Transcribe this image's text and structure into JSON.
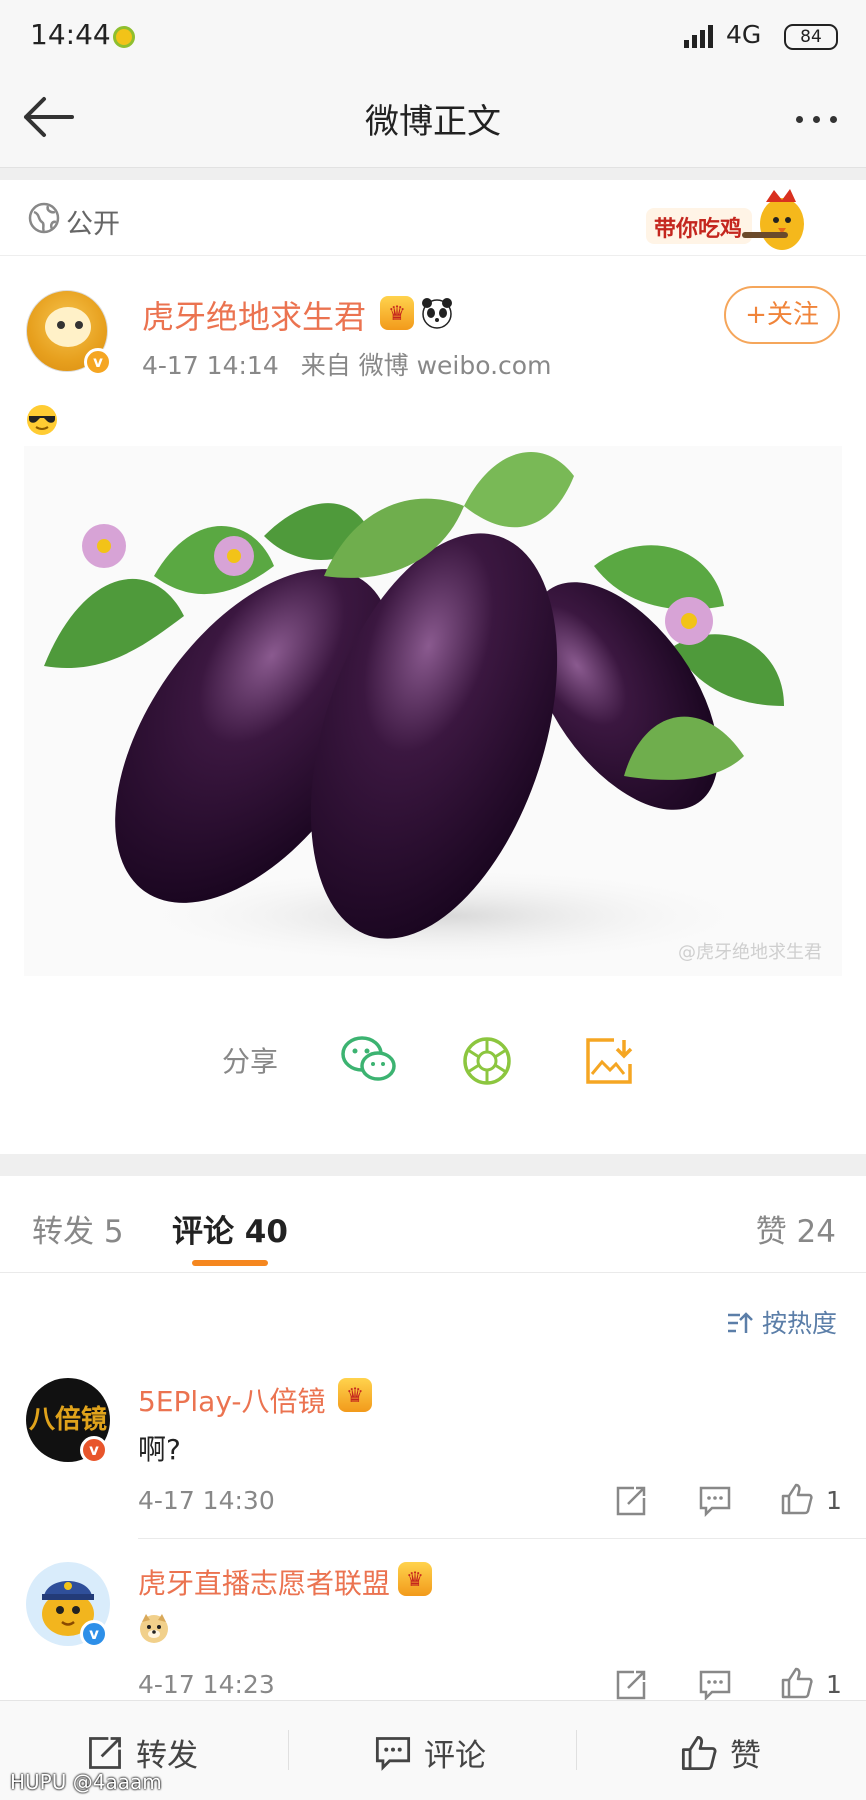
{
  "status_bar": {
    "time": "14:44",
    "network": "4G",
    "battery": "84"
  },
  "nav": {
    "title": "微博正文"
  },
  "visibility": "公开",
  "sticker_text": "带你吃鸡",
  "post": {
    "author": "虎牙绝地求生君",
    "time": "4-17 14:14",
    "source": "来自 微博 weibo.com",
    "follow_label": "+关注",
    "image_watermark": "@虎牙绝地求生君"
  },
  "share": {
    "label": "分享"
  },
  "tabs": {
    "repost": "转发 5",
    "comment": "评论 40",
    "like": "赞 24"
  },
  "sort_label": "按热度",
  "comments": [
    {
      "user": "5EPlay-八倍镜",
      "avatar_text": "八倍镜",
      "text": "啊?",
      "time": "4-17 14:30",
      "likes": "1"
    },
    {
      "user": "虎牙直播志愿者联盟",
      "text": "",
      "time": "4-17 14:23",
      "likes": "1"
    }
  ],
  "bottom_bar": {
    "repost": "转发",
    "comment": "评论",
    "like": "赞"
  },
  "footer_watermark": "HUPU @4aaam",
  "colors": {
    "accent_orange": "#eb7350",
    "link_blue": "#5b7ea8",
    "wechat_green": "#3cb371"
  }
}
